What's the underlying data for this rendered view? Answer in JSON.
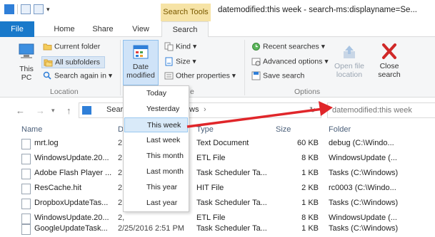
{
  "window": {
    "title": "datemodified:this week - search-ms:displayname=Se...",
    "context_tab": "Search Tools"
  },
  "tabs": [
    "File",
    "Home",
    "Share",
    "View",
    "Search"
  ],
  "ribbon": {
    "location": {
      "this_pc": "This PC",
      "current_folder": "Current folder",
      "all_subfolders": "All subfolders",
      "search_again": "Search again in",
      "label": "Location"
    },
    "refine": {
      "date_modified_line1": "Date",
      "date_modified_line2": "modified",
      "kind": "Kind",
      "size": "Size",
      "other_properties": "Other properties",
      "label": "e"
    },
    "options": {
      "recent_searches": "Recent searches",
      "advanced_options": "Advanced options",
      "save_search": "Save search",
      "open_file_location_1": "Open file",
      "open_file_location_2": "location",
      "close_search_1": "Close",
      "close_search_2": "search",
      "label": "Options"
    }
  },
  "address": {
    "path_start": "Searc",
    "path_end": "ws",
    "search_value": "datemodified:this week"
  },
  "dropdown": {
    "items": [
      "Today",
      "Yesterday",
      "This week",
      "Last week",
      "This month",
      "Last month",
      "This year",
      "Last year"
    ],
    "selected": "This week"
  },
  "columns": {
    "name": "Name",
    "date": "D",
    "type": "Type",
    "size": "Size",
    "folder": "Folder"
  },
  "files": [
    {
      "name": "mrt.log",
      "date": "2,",
      "type": "Text Document",
      "size": "60 KB",
      "folder": "debug (C:\\Windo..."
    },
    {
      "name": "WindowsUpdate.20...",
      "date": "2,",
      "type": "ETL File",
      "size": "8 KB",
      "folder": "WindowsUpdate (..."
    },
    {
      "name": "Adobe Flash Player ...",
      "date": "2,",
      "type": "Task Scheduler Ta...",
      "size": "1 KB",
      "folder": "Tasks (C:\\Windows)"
    },
    {
      "name": "ResCache.hit",
      "date": "2,",
      "type": "HIT File",
      "size": "2 KB",
      "folder": "rc0003 (C:\\Windo..."
    },
    {
      "name": "DropboxUpdateTas...",
      "date": "2,",
      "type": "Task Scheduler Ta...",
      "size": "1 KB",
      "folder": "Tasks (C:\\Windows)"
    },
    {
      "name": "WindowsUpdate.20...",
      "date": "2,",
      "type": "ETL File",
      "size": "8 KB",
      "folder": "WindowsUpdate (..."
    },
    {
      "name": "GoogleUpdateTask...",
      "date": "2/25/2016 2:51 PM",
      "type": "Task Scheduler Ta...",
      "size": "1 KB",
      "folder": "Tasks (C:\\Windows)"
    }
  ],
  "colors": {
    "file_tab": "#1979ca",
    "context_tab": "#f6e3a6",
    "arrow": "#e0262a",
    "selection": "#d9eaf9"
  }
}
